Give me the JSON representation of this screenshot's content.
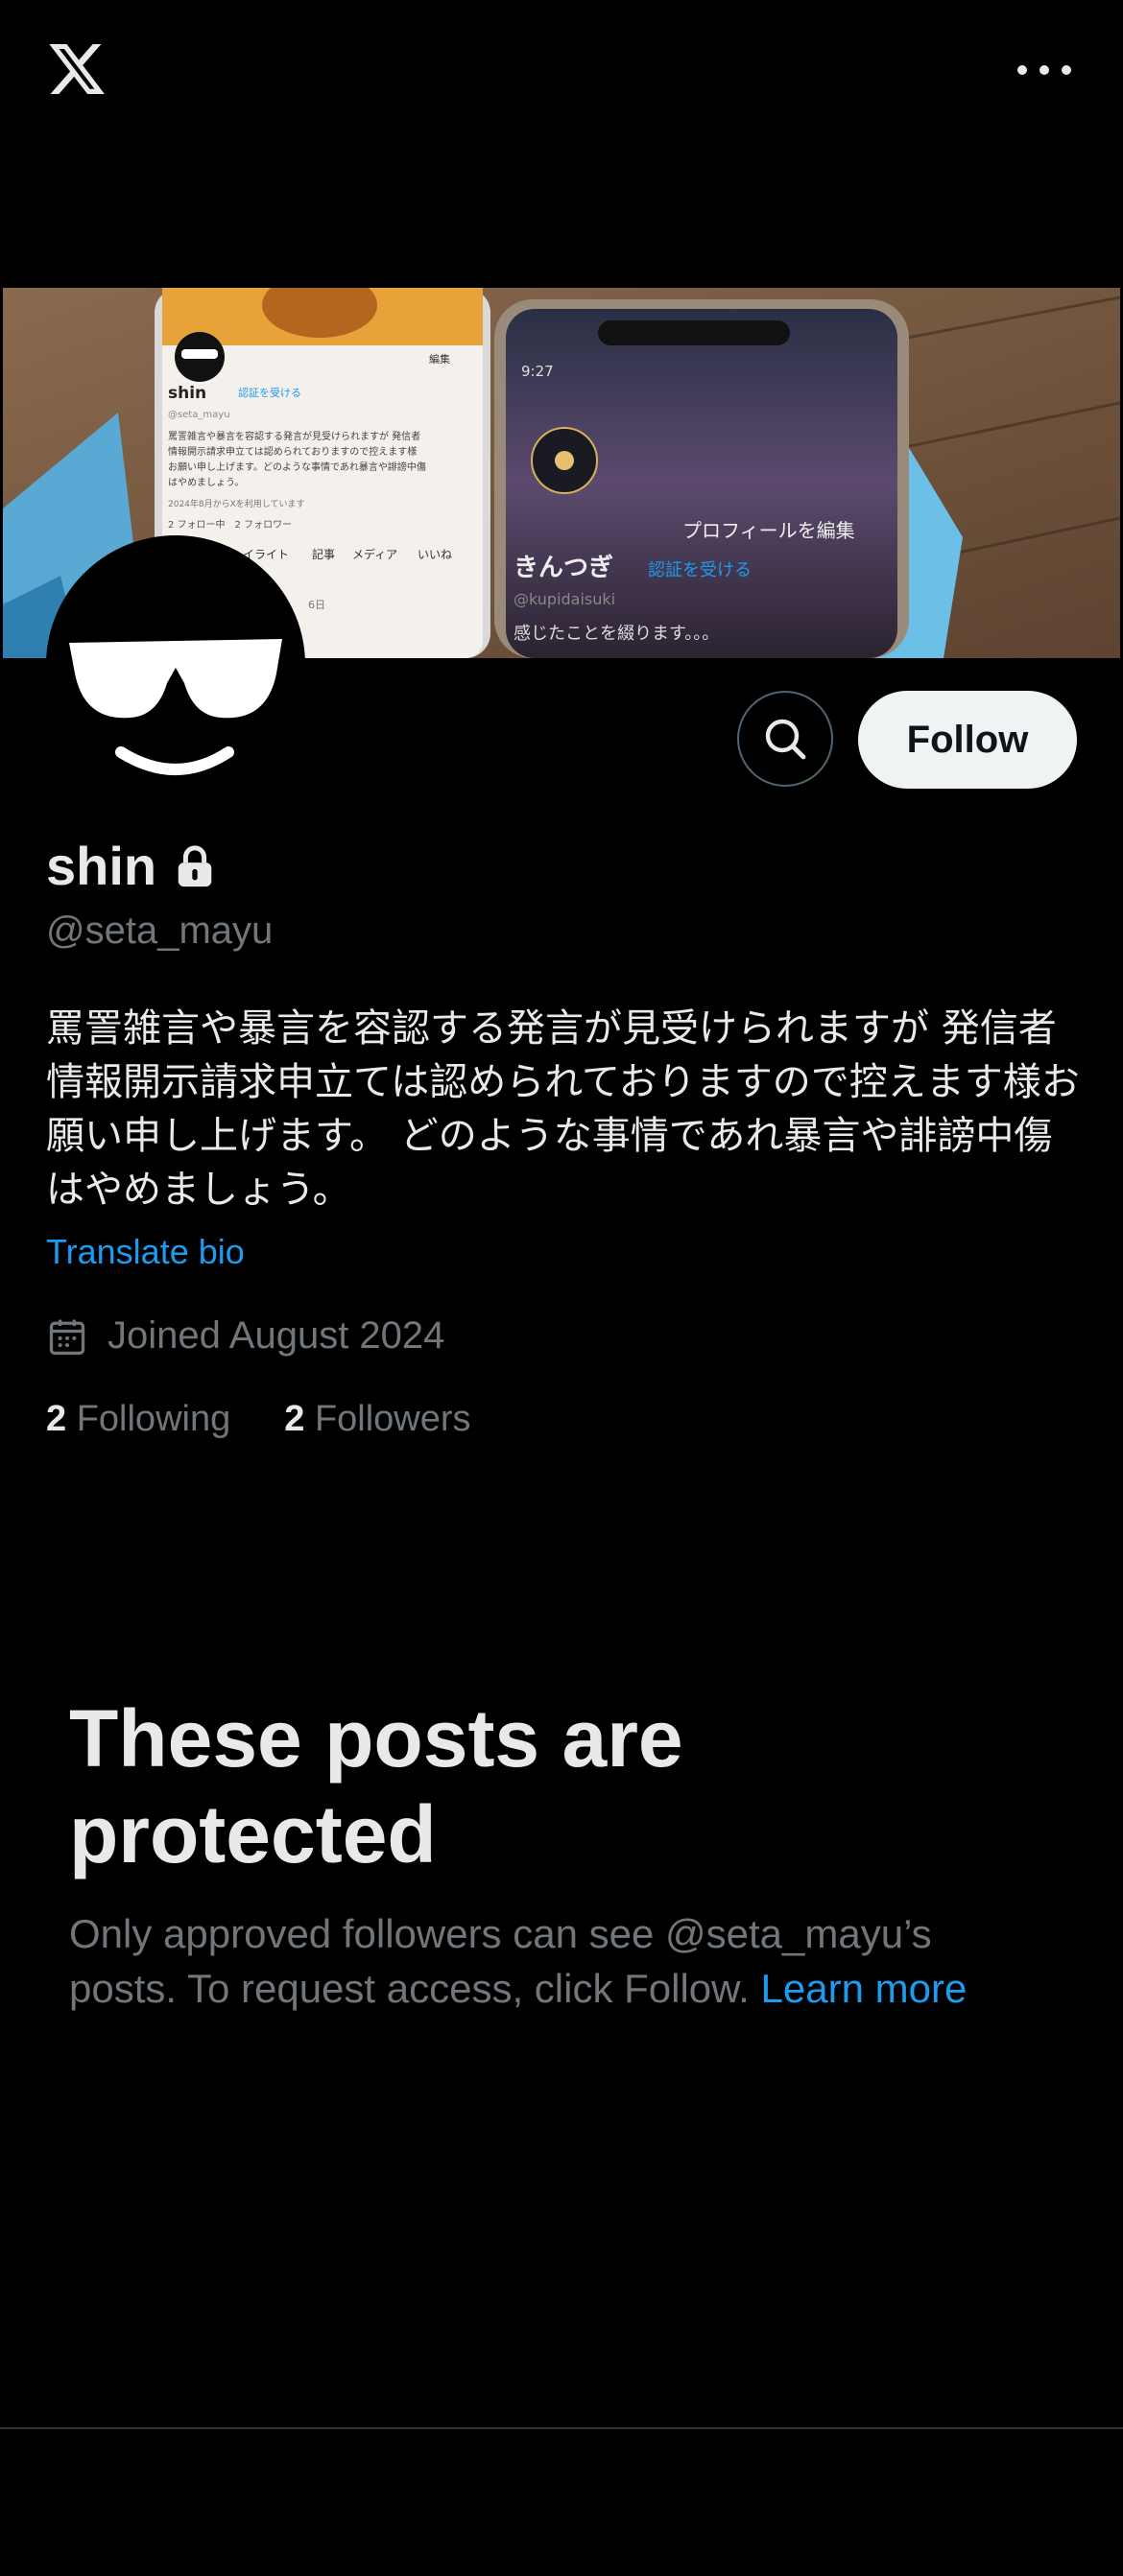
{
  "header": {
    "logo_icon": "x-logo",
    "more_icon": "more-horizontal-icon"
  },
  "profile": {
    "name": "shin",
    "handle": "@seta_mayu",
    "bio": "罵詈雑言や暴言を容認する発言が見受けられますが 発信者情報開示請求申立ては認められておりますので控えます様お願い申し上げます。 どのような事情であれ暴言や誹謗中傷はやめましょう。",
    "translate_label": "Translate bio",
    "joined": "Joined August 2024",
    "following_count": "2",
    "following_label": "Following",
    "followers_count": "2",
    "followers_label": "Followers"
  },
  "actions": {
    "follow_label": "Follow",
    "search_icon": "search-icon"
  },
  "banner": {
    "left_phone": {
      "name": "shin",
      "badge": "認証を受ける",
      "handle": "@seta_mayu",
      "edit": "編集",
      "bio_snippet": [
        "罵詈雑言や暴言を容認する発言が見受けられますが 発信者",
        "情報開示請求申立ては認められておりますので控えます様",
        "お願い申し上げます。どのような事情であれ暴言や誹謗中傷",
        "はやめましょう。"
      ],
      "joined": "2024年8月からXを利用しています",
      "stats": "2 フォロー中　2 フォロワー",
      "tabs": [
        "イライト",
        "記事",
        "メディア",
        "いいね"
      ],
      "date": "6日"
    },
    "right_phone": {
      "time": "9:27",
      "edit_profile": "プロフィールを編集",
      "name": "きんつぎ",
      "badge": "認証を受ける",
      "handle": "@kupidaisuki",
      "bio": "感じたことを綴ります。。。"
    }
  },
  "protected": {
    "title": "These posts are protected",
    "desc": "Only approved followers can see @seta_mayu’s posts. To request access, click Follow.",
    "learn_more": "Learn more"
  },
  "colors": {
    "accent": "#1d9bf0",
    "text": "#e7e9ea",
    "muted": "#71767b",
    "background": "#000000"
  }
}
